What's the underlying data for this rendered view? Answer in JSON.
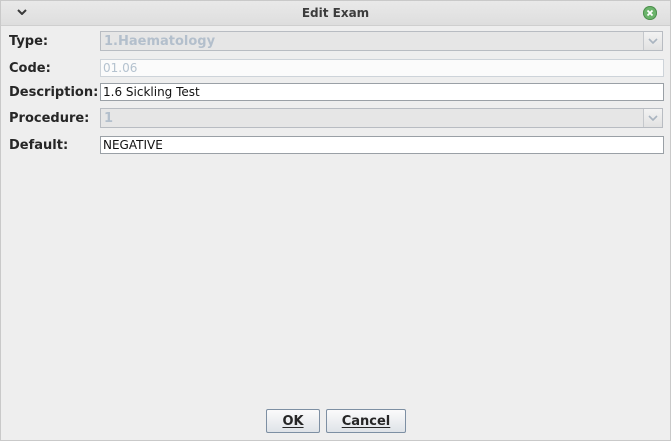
{
  "window": {
    "title": "Edit Exam",
    "menu_icon": "chevron-down-icon",
    "close_icon": "close-icon"
  },
  "form": {
    "type": {
      "label": "Type:",
      "value": "1.Haematology"
    },
    "code": {
      "label": "Code:",
      "value": "01.06"
    },
    "description": {
      "label": "Description:",
      "value": "1.6 Sickling Test"
    },
    "procedure": {
      "label": "Procedure:",
      "value": "1"
    },
    "default": {
      "label": "Default:",
      "value": "NEGATIVE"
    }
  },
  "buttons": {
    "ok": "OK",
    "cancel": "Cancel"
  },
  "colors": {
    "close_button": "#6bb46b",
    "disabled_text": "#b3bfcc",
    "button_border": "#7d8fa3"
  }
}
